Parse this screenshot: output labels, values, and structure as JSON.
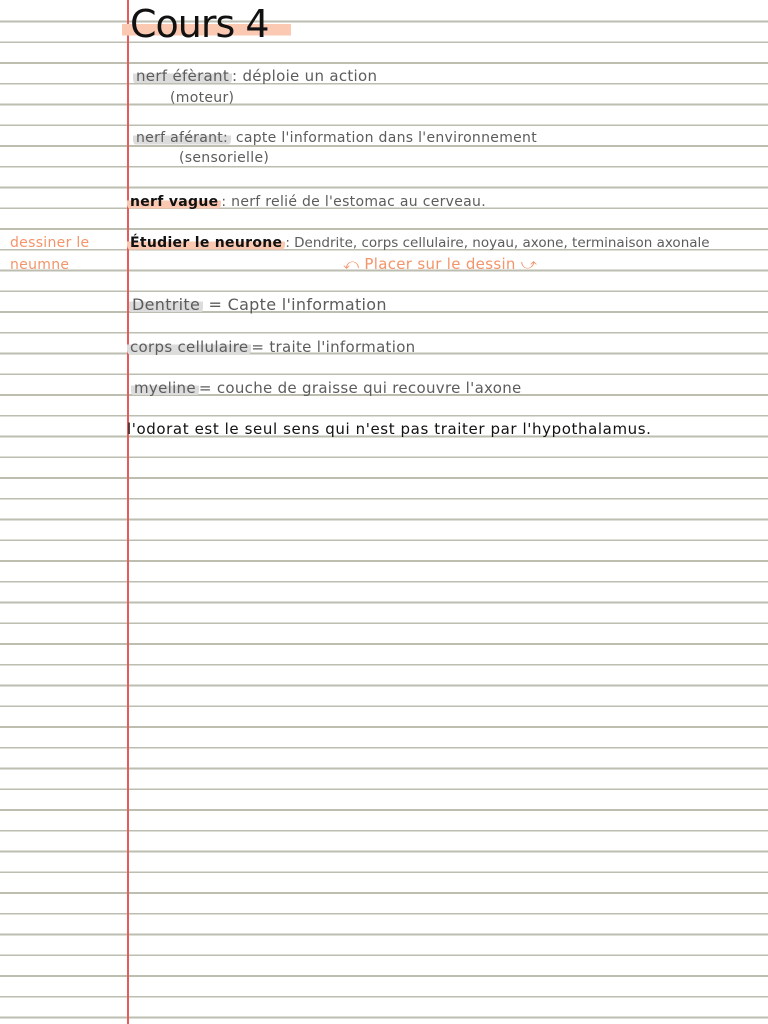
{
  "title": "Cours 4",
  "margin_note": {
    "line1": "dessiner le",
    "line2": "neumne"
  },
  "notes": [
    {
      "term": "nerf éfèrant",
      "definition": ": déploie un action",
      "sub": "(moteur)"
    },
    {
      "term": "nerf aférant:",
      "definition": "capte l'information dans l'environnement",
      "sub": "(sensorielle)"
    },
    {
      "term": "nerf vague",
      "definition": ": nerf relié de l'estomac au cerveau."
    },
    {
      "term": "Étudier le neurone",
      "definition": ": Dendrite, corps cellulaire, noyau, axone, terminaison axonale",
      "sub": "Placer sur le dessin"
    },
    {
      "term": "Dentrite",
      "definition": "= Capte l'information"
    },
    {
      "term": "corps cellulaire",
      "definition": "= traite l'information"
    },
    {
      "term": "myeline",
      "definition": "= couche de graisse qui recouvre l'axone"
    }
  ],
  "statement": "l'odorat est le seul sens qui n'est pas traiter par l'hypothalamus.",
  "arrows": {
    "left": "⤺",
    "right": "⤻"
  },
  "colors": {
    "margin_line": "#e8595a",
    "rule_line": "#bdbdb0",
    "peach": "#fbc9b1",
    "orange_ink": "#f4946a",
    "grey_ink": "#5c5c5c"
  }
}
